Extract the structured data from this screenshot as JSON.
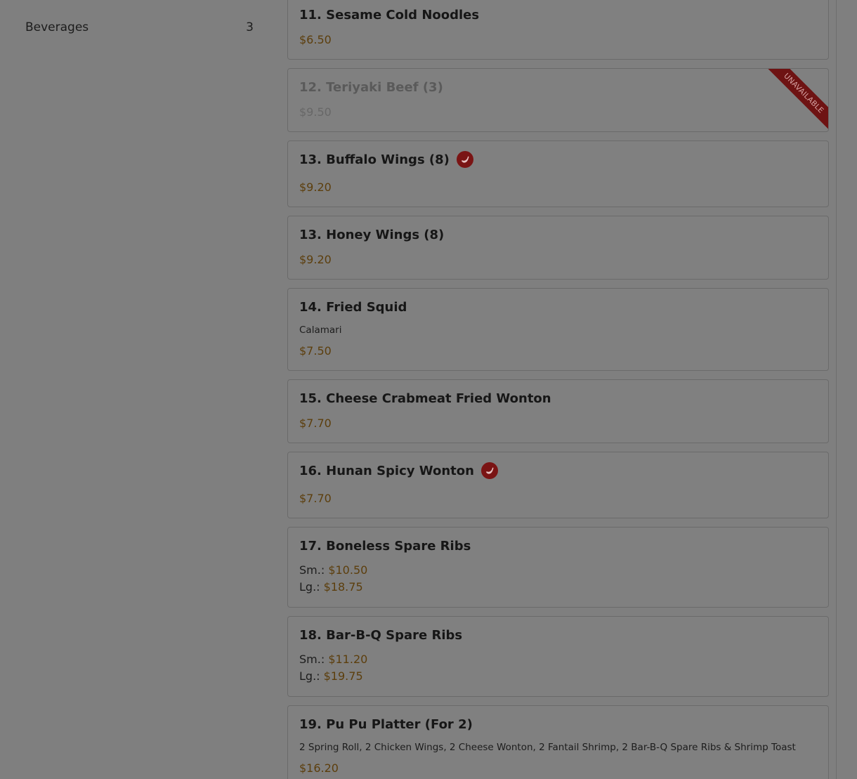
{
  "sidebar": {
    "categories": [
      {
        "label": "Beverages",
        "count": "3"
      }
    ]
  },
  "menu": {
    "items": [
      {
        "name": "11. Sesame Cold Noodles",
        "price": "$6.50"
      },
      {
        "name": "12. Teriyaki Beef (3)",
        "price": "$9.50",
        "badge": "UNAVAILABLE"
      },
      {
        "name": "13. Buffalo Wings (8)",
        "price": "$9.20",
        "icon": "chili-pepper-icon"
      },
      {
        "name": "13. Honey Wings (8)",
        "price": "$9.20"
      },
      {
        "name": "14. Fried Squid",
        "desc": "Calamari",
        "price": "$7.50"
      },
      {
        "name": "15. Cheese Crabmeat Fried Wonton",
        "price": "$7.70"
      },
      {
        "name": "16. Hunan Spicy Wonton",
        "price": "$7.70",
        "icon": "chili-pepper-icon"
      },
      {
        "name": "17. Boneless Spare Ribs",
        "sm_label": "Sm.: ",
        "sm_price": "$10.50",
        "lg_label": "Lg.: ",
        "lg_price": "$18.75"
      },
      {
        "name": "18. Bar-B-Q Spare Ribs",
        "sm_label": "Sm.: ",
        "sm_price": "$11.20",
        "lg_label": "Lg.: ",
        "lg_price": "$19.75"
      },
      {
        "name": "19. Pu Pu Platter (For 2)",
        "desc": "2 Spring Roll, 2 Chicken Wings, 2 Cheese Wonton, 2 Fantail Shrimp, 2 Bar-B-Q Spare Ribs & Shrimp Toast",
        "price": "$16.20"
      }
    ]
  },
  "colors": {
    "overlay_bg": "#7f7f7f",
    "price": "#5c3e0c",
    "accent_red": "#7a1414"
  }
}
